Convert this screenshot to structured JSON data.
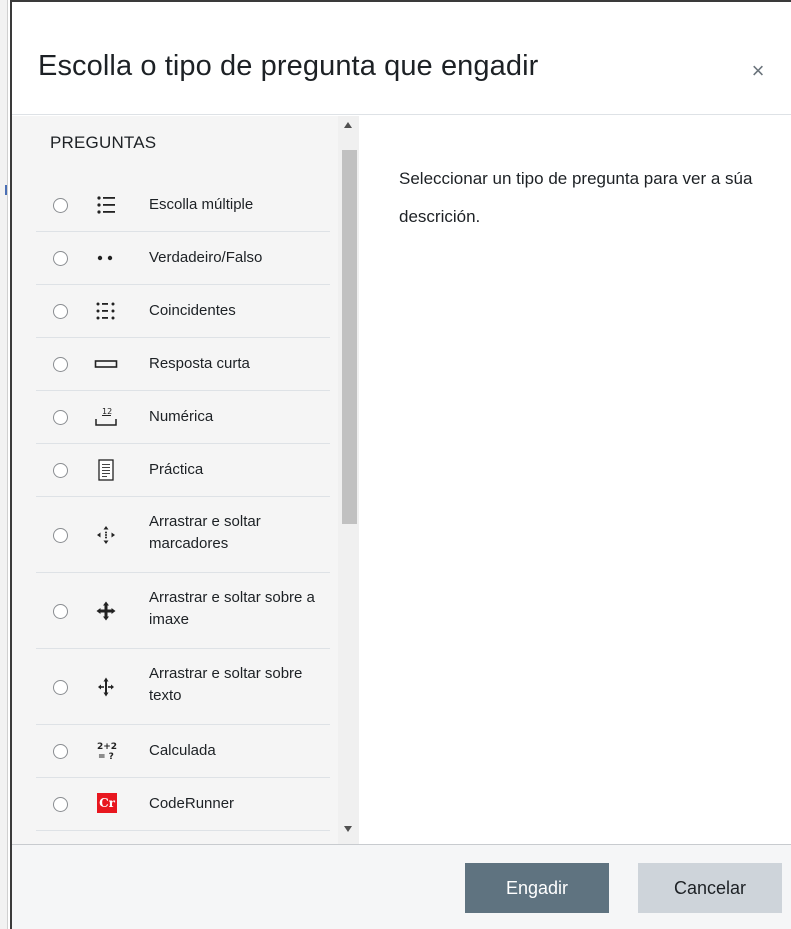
{
  "modal": {
    "title": "Escolla o tipo de pregunta que engadir",
    "close_symbol": "×"
  },
  "options": {
    "section_label": "PREGUNTAS",
    "items": [
      {
        "label": "Escolla múltiple",
        "icon": "multiple-choice-icon"
      },
      {
        "label": "Verdadeiro/Falso",
        "icon": "true-false-icon"
      },
      {
        "label": "Coincidentes",
        "icon": "matching-icon"
      },
      {
        "label": "Resposta curta",
        "icon": "short-answer-icon"
      },
      {
        "label": "Numérica",
        "icon": "numerical-icon"
      },
      {
        "label": "Práctica",
        "icon": "essay-icon"
      },
      {
        "label": "Arrastrar e soltar marcadores",
        "icon": "drag-drop-markers-icon"
      },
      {
        "label": "Arrastrar e soltar sobre a imaxe",
        "icon": "drag-drop-image-icon"
      },
      {
        "label": "Arrastrar e soltar sobre texto",
        "icon": "drag-drop-text-icon"
      },
      {
        "label": "Calculada",
        "icon": "calculated-icon",
        "icon_text": "2+2\n= ?"
      },
      {
        "label": "CodeRunner",
        "icon": "coderunner-icon",
        "icon_text": "Cr"
      }
    ]
  },
  "description": {
    "text": "Seleccionar un tipo de pregunta para ver a súa descrición."
  },
  "footer": {
    "add_label": "Engadir",
    "cancel_label": "Cancelar"
  },
  "colors": {
    "add_button": "#5f7380",
    "cancel_button": "#ced4da",
    "coderunner_badge": "#e8171f",
    "list_background": "#f5f5f5"
  }
}
